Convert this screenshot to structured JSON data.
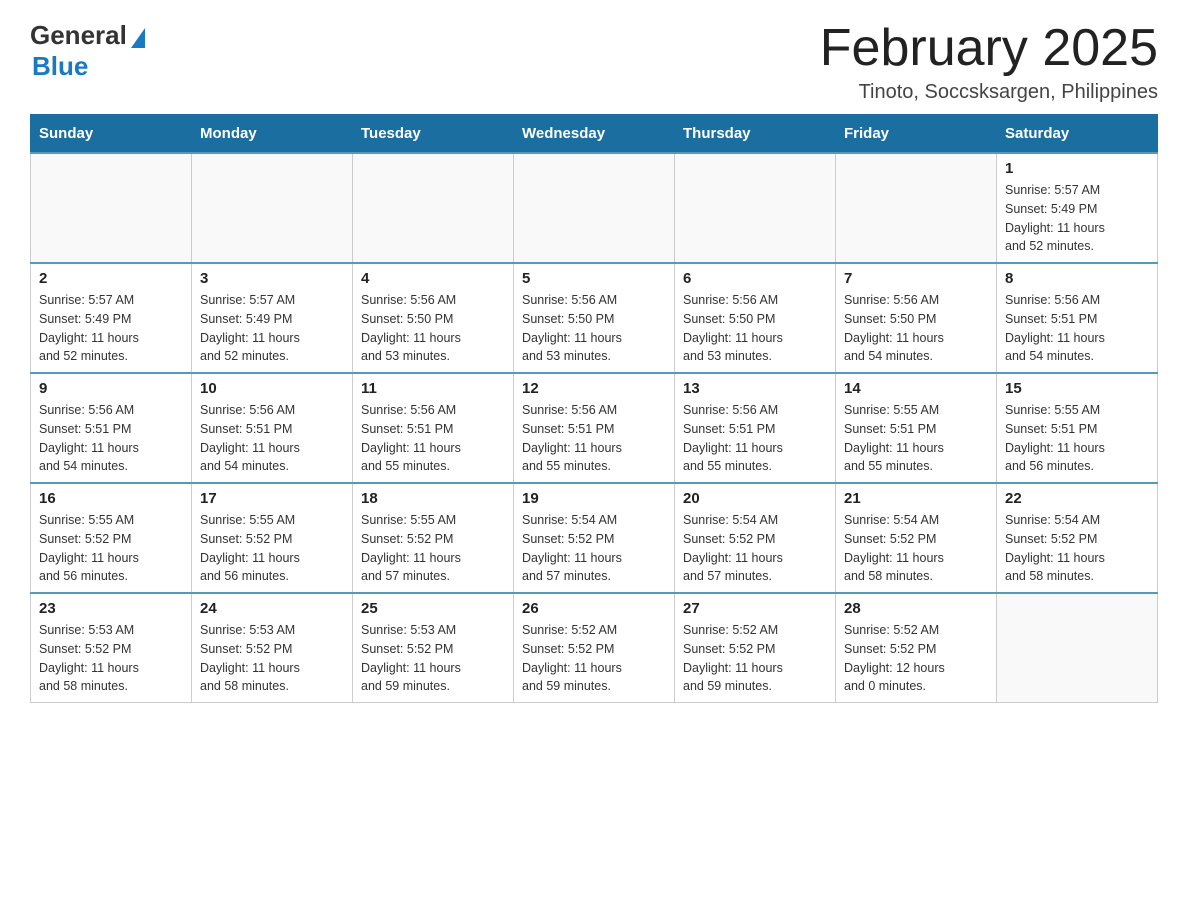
{
  "logo": {
    "general": "General",
    "blue": "Blue"
  },
  "header": {
    "title": "February 2025",
    "subtitle": "Tinoto, Soccsksargen, Philippines"
  },
  "weekdays": [
    "Sunday",
    "Monday",
    "Tuesday",
    "Wednesday",
    "Thursday",
    "Friday",
    "Saturday"
  ],
  "weeks": [
    {
      "days": [
        {
          "date": "",
          "info": ""
        },
        {
          "date": "",
          "info": ""
        },
        {
          "date": "",
          "info": ""
        },
        {
          "date": "",
          "info": ""
        },
        {
          "date": "",
          "info": ""
        },
        {
          "date": "",
          "info": ""
        },
        {
          "date": "1",
          "info": "Sunrise: 5:57 AM\nSunset: 5:49 PM\nDaylight: 11 hours\nand 52 minutes."
        }
      ]
    },
    {
      "days": [
        {
          "date": "2",
          "info": "Sunrise: 5:57 AM\nSunset: 5:49 PM\nDaylight: 11 hours\nand 52 minutes."
        },
        {
          "date": "3",
          "info": "Sunrise: 5:57 AM\nSunset: 5:49 PM\nDaylight: 11 hours\nand 52 minutes."
        },
        {
          "date": "4",
          "info": "Sunrise: 5:56 AM\nSunset: 5:50 PM\nDaylight: 11 hours\nand 53 minutes."
        },
        {
          "date": "5",
          "info": "Sunrise: 5:56 AM\nSunset: 5:50 PM\nDaylight: 11 hours\nand 53 minutes."
        },
        {
          "date": "6",
          "info": "Sunrise: 5:56 AM\nSunset: 5:50 PM\nDaylight: 11 hours\nand 53 minutes."
        },
        {
          "date": "7",
          "info": "Sunrise: 5:56 AM\nSunset: 5:50 PM\nDaylight: 11 hours\nand 54 minutes."
        },
        {
          "date": "8",
          "info": "Sunrise: 5:56 AM\nSunset: 5:51 PM\nDaylight: 11 hours\nand 54 minutes."
        }
      ]
    },
    {
      "days": [
        {
          "date": "9",
          "info": "Sunrise: 5:56 AM\nSunset: 5:51 PM\nDaylight: 11 hours\nand 54 minutes."
        },
        {
          "date": "10",
          "info": "Sunrise: 5:56 AM\nSunset: 5:51 PM\nDaylight: 11 hours\nand 54 minutes."
        },
        {
          "date": "11",
          "info": "Sunrise: 5:56 AM\nSunset: 5:51 PM\nDaylight: 11 hours\nand 55 minutes."
        },
        {
          "date": "12",
          "info": "Sunrise: 5:56 AM\nSunset: 5:51 PM\nDaylight: 11 hours\nand 55 minutes."
        },
        {
          "date": "13",
          "info": "Sunrise: 5:56 AM\nSunset: 5:51 PM\nDaylight: 11 hours\nand 55 minutes."
        },
        {
          "date": "14",
          "info": "Sunrise: 5:55 AM\nSunset: 5:51 PM\nDaylight: 11 hours\nand 55 minutes."
        },
        {
          "date": "15",
          "info": "Sunrise: 5:55 AM\nSunset: 5:51 PM\nDaylight: 11 hours\nand 56 minutes."
        }
      ]
    },
    {
      "days": [
        {
          "date": "16",
          "info": "Sunrise: 5:55 AM\nSunset: 5:52 PM\nDaylight: 11 hours\nand 56 minutes."
        },
        {
          "date": "17",
          "info": "Sunrise: 5:55 AM\nSunset: 5:52 PM\nDaylight: 11 hours\nand 56 minutes."
        },
        {
          "date": "18",
          "info": "Sunrise: 5:55 AM\nSunset: 5:52 PM\nDaylight: 11 hours\nand 57 minutes."
        },
        {
          "date": "19",
          "info": "Sunrise: 5:54 AM\nSunset: 5:52 PM\nDaylight: 11 hours\nand 57 minutes."
        },
        {
          "date": "20",
          "info": "Sunrise: 5:54 AM\nSunset: 5:52 PM\nDaylight: 11 hours\nand 57 minutes."
        },
        {
          "date": "21",
          "info": "Sunrise: 5:54 AM\nSunset: 5:52 PM\nDaylight: 11 hours\nand 58 minutes."
        },
        {
          "date": "22",
          "info": "Sunrise: 5:54 AM\nSunset: 5:52 PM\nDaylight: 11 hours\nand 58 minutes."
        }
      ]
    },
    {
      "days": [
        {
          "date": "23",
          "info": "Sunrise: 5:53 AM\nSunset: 5:52 PM\nDaylight: 11 hours\nand 58 minutes."
        },
        {
          "date": "24",
          "info": "Sunrise: 5:53 AM\nSunset: 5:52 PM\nDaylight: 11 hours\nand 58 minutes."
        },
        {
          "date": "25",
          "info": "Sunrise: 5:53 AM\nSunset: 5:52 PM\nDaylight: 11 hours\nand 59 minutes."
        },
        {
          "date": "26",
          "info": "Sunrise: 5:52 AM\nSunset: 5:52 PM\nDaylight: 11 hours\nand 59 minutes."
        },
        {
          "date": "27",
          "info": "Sunrise: 5:52 AM\nSunset: 5:52 PM\nDaylight: 11 hours\nand 59 minutes."
        },
        {
          "date": "28",
          "info": "Sunrise: 5:52 AM\nSunset: 5:52 PM\nDaylight: 12 hours\nand 0 minutes."
        },
        {
          "date": "",
          "info": ""
        }
      ]
    }
  ]
}
